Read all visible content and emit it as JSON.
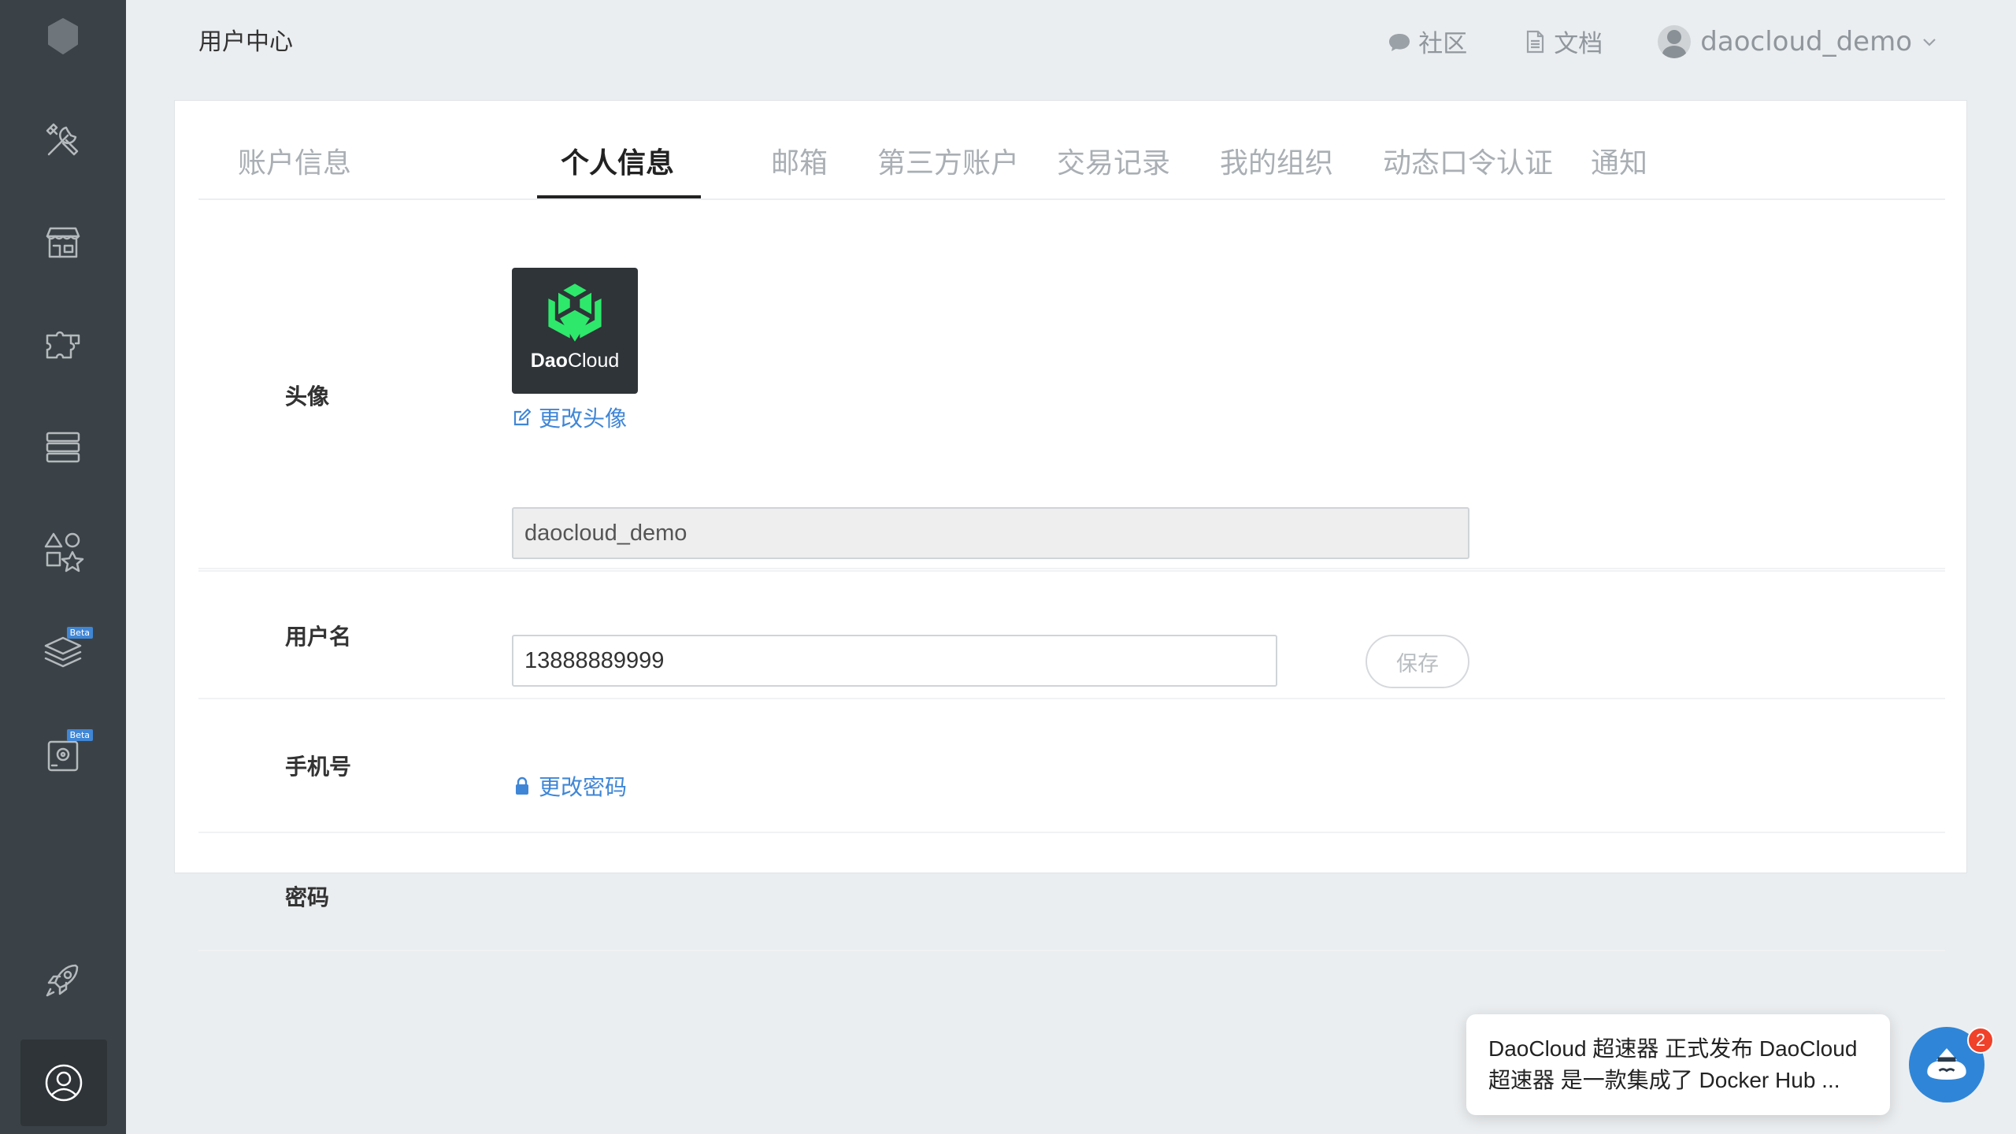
{
  "header": {
    "page_title": "用户中心",
    "community_label": "社区",
    "docs_label": "文档",
    "username": "daocloud_demo"
  },
  "sidebar": {
    "items": [
      {
        "name": "logo",
        "icon": "cube-logo-icon"
      },
      {
        "name": "build",
        "icon": "tools-icon"
      },
      {
        "name": "store",
        "icon": "store-icon"
      },
      {
        "name": "services",
        "icon": "puzzle-icon"
      },
      {
        "name": "clusters",
        "icon": "server-icon"
      },
      {
        "name": "apps",
        "icon": "shapes-icon"
      },
      {
        "name": "layers",
        "icon": "layers-icon",
        "badge": "Beta"
      },
      {
        "name": "storage",
        "icon": "disk-icon",
        "badge": "Beta"
      },
      {
        "name": "launch",
        "icon": "rocket-icon"
      },
      {
        "name": "user-center",
        "icon": "user-circle-icon",
        "active": true
      }
    ]
  },
  "tabs": [
    {
      "label": "账户信息",
      "active": false
    },
    {
      "label": "个人信息",
      "active": true
    },
    {
      "label": "邮箱",
      "active": false
    },
    {
      "label": "第三方账户",
      "active": false
    },
    {
      "label": "交易记录",
      "active": false
    },
    {
      "label": "我的组织",
      "active": false
    },
    {
      "label": "动态口令认证",
      "active": false
    },
    {
      "label": "通知",
      "active": false
    }
  ],
  "profile": {
    "avatar_label": "头像",
    "avatar_brand_bold": "Dao",
    "avatar_brand_rest": "Cloud",
    "change_avatar": "更改头像",
    "username_label": "用户名",
    "username_value": "daocloud_demo",
    "phone_label": "手机号",
    "phone_value": "13888889999",
    "save_label": "保存",
    "password_label": "密码",
    "change_password": "更改密码"
  },
  "chat": {
    "line1": "DaoCloud 超速器 正式发布 DaoCloud",
    "line2": "超速器 是一款集成了 Docker Hub ...",
    "unread": "2"
  },
  "colors": {
    "sidebar_bg": "#3b4247",
    "accent_link": "#3f86d6",
    "brand_green": "#2ee86b",
    "badge_red": "#f0412a"
  }
}
